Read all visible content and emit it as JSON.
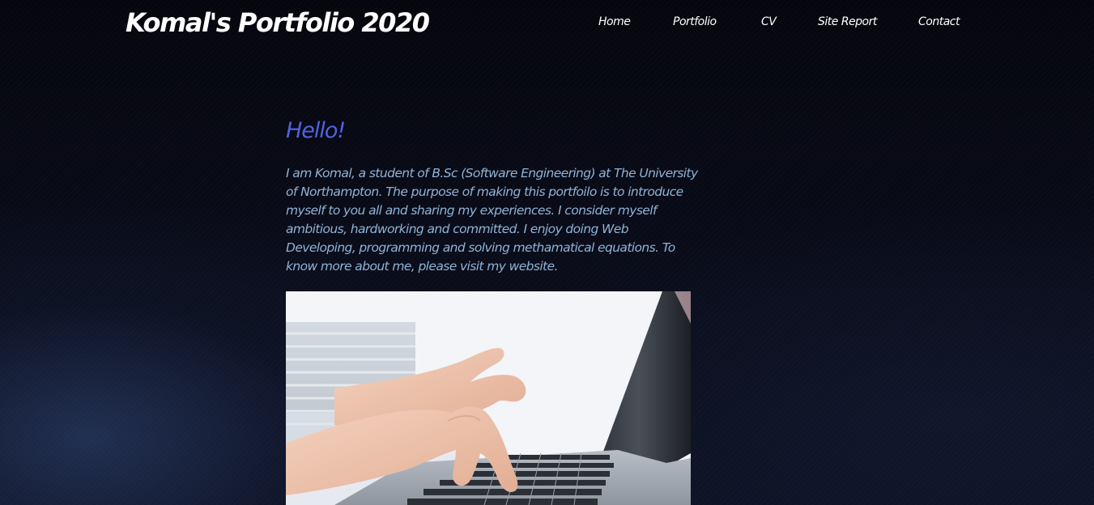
{
  "header": {
    "site_title": "Komal's Portfolio 2020",
    "nav": [
      {
        "label": "Home"
      },
      {
        "label": "Portfolio"
      },
      {
        "label": "CV"
      },
      {
        "label": "Site Report"
      },
      {
        "label": "Contact"
      }
    ]
  },
  "main": {
    "greeting": "Hello!",
    "intro": "I am Komal, a student of B.Sc (Software Engineering) at The University of Northampton. The purpose of making this portfoilo is to introduce myself to you all and sharing my experiences. I consider myself ambitious, hardworking and committed. I enjoy doing Web Developing, programming and solving methamatical equations. To know more about me, please visit my website.",
    "image": {
      "subject": "hands-typing-on-laptop"
    }
  },
  "colors": {
    "greeting": "#4f63e0",
    "intro_text": "#8fb4d6",
    "nav_text": "#ffffff",
    "background": "#06070f"
  }
}
